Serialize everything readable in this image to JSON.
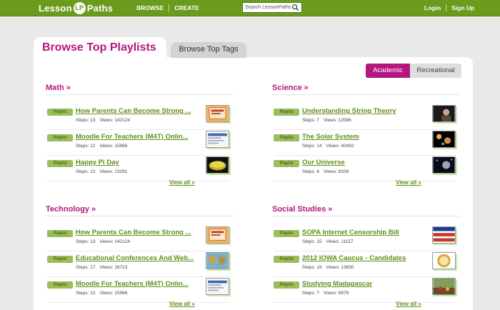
{
  "header": {
    "logo_left": "Lesson",
    "logo_mark": "LP",
    "logo_right": "Paths",
    "nav": [
      "BROWSE",
      "CREATE"
    ],
    "search_placeholder": "Search LessonPaths",
    "auth": [
      "Login",
      "Sign Up"
    ]
  },
  "tabs": {
    "active": "Browse Top Playlists",
    "inactive": "Browse Top Tags"
  },
  "toggle": {
    "active": "Academic",
    "inactive": "Recreational"
  },
  "badge_label": "Playlist",
  "steps_label": "Steps:",
  "views_label": "Views:",
  "view_all": "View all »",
  "colors": {
    "brand_green": "#6b9b1c",
    "accent_magenta": "#b4177f",
    "link_green": "#5f8f17"
  },
  "sections": [
    {
      "title": "Math »",
      "items": [
        {
          "title": "How Parents Can Become Strong ...",
          "steps": "13",
          "views": "142124",
          "thumb": "presentation"
        },
        {
          "title": "Moodle For Teachers (M4T) Onlin...",
          "steps": "12",
          "views": "15966",
          "thumb": "webpage"
        },
        {
          "title": "Happy Pi Day",
          "steps": "12",
          "views": "23291",
          "thumb": "pie"
        }
      ]
    },
    {
      "title": "Science »",
      "items": [
        {
          "title": "Understanding String Theory",
          "steps": "7",
          "views": "12586",
          "thumb": "video"
        },
        {
          "title": "The Solar System",
          "steps": "14",
          "views": "40492",
          "thumb": "planets"
        },
        {
          "title": "Our Universe",
          "steps": "4",
          "views": "8339",
          "thumb": "space"
        }
      ]
    },
    {
      "title": "Technology »",
      "items": [
        {
          "title": "How Parents Can Become Strong ...",
          "steps": "13",
          "views": "142124",
          "thumb": "presentation"
        },
        {
          "title": "Educational Conferences And Web...",
          "steps": "17",
          "views": "16713",
          "thumb": "map"
        },
        {
          "title": "Moodle For Teachers (M4T) Onlin...",
          "steps": "12",
          "views": "15966",
          "thumb": "webpage"
        }
      ]
    },
    {
      "title": "Social Studies »",
      "items": [
        {
          "title": "SOPA Internet Censorship Bill",
          "steps": "15",
          "views": "11157",
          "thumb": "flag"
        },
        {
          "title": "2012 IOWA Caucus - Candidates",
          "steps": "19",
          "views": "13830",
          "thumb": "seal"
        },
        {
          "title": "Studying Madagascar",
          "steps": "7",
          "views": "6979",
          "thumb": "photo"
        }
      ]
    }
  ]
}
